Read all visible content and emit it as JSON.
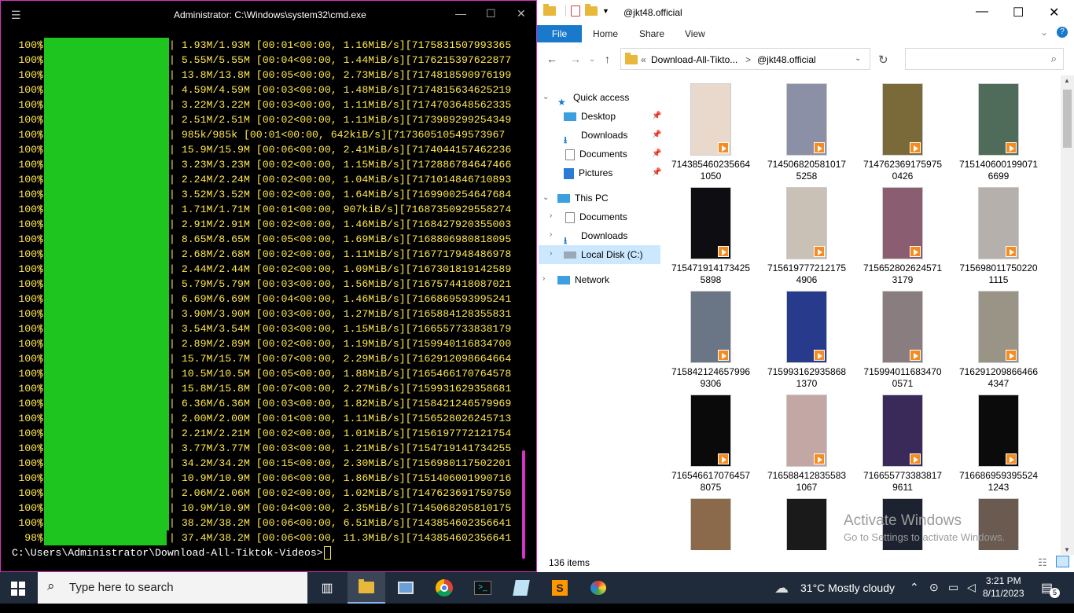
{
  "cmd": {
    "title": "Administrator: C:\\Windows\\system32\\cmd.exe",
    "rows": [
      {
        "pct": "100%",
        "rest": "| 1.93M/1.93M [00:01<00:00, 1.16MiB/s][7175831507993365"
      },
      {
        "pct": "100%",
        "rest": "| 5.55M/5.55M [00:04<00:00, 1.44MiB/s][7176215397622877"
      },
      {
        "pct": "100%",
        "rest": "| 13.8M/13.8M [00:05<00:00, 2.73MiB/s][7174818590976199"
      },
      {
        "pct": "100%",
        "rest": "| 4.59M/4.59M [00:03<00:00, 1.48MiB/s][7174815634625219"
      },
      {
        "pct": "100%",
        "rest": "| 3.22M/3.22M [00:03<00:00, 1.11MiB/s][7174703648562335"
      },
      {
        "pct": "100%",
        "rest": "| 2.51M/2.51M [00:02<00:00, 1.11MiB/s][7173989299254349"
      },
      {
        "pct": "100%",
        "rest": "| 985k/985k [00:01<00:00, 642kiB/s][717360510549573967"
      },
      {
        "pct": "100%",
        "rest": "| 15.9M/15.9M [00:06<00:00, 2.41MiB/s][7174044157462236"
      },
      {
        "pct": "100%",
        "rest": "| 3.23M/3.23M [00:02<00:00, 1.15MiB/s][7172886784647466"
      },
      {
        "pct": "100%",
        "rest": "| 2.24M/2.24M [00:02<00:00, 1.04MiB/s][7171014846710893"
      },
      {
        "pct": "100%",
        "rest": "| 3.52M/3.52M [00:02<00:00, 1.64MiB/s][7169900254647684"
      },
      {
        "pct": "100%",
        "rest": "| 1.71M/1.71M [00:01<00:00, 907kiB/s][71687350929558274"
      },
      {
        "pct": "100%",
        "rest": "| 2.91M/2.91M [00:02<00:00, 1.46MiB/s][7168427920355003"
      },
      {
        "pct": "100%",
        "rest": "| 8.65M/8.65M [00:05<00:00, 1.69MiB/s][7168806980818095"
      },
      {
        "pct": "100%",
        "rest": "| 2.68M/2.68M [00:02<00:00, 1.11MiB/s][7167717948486978"
      },
      {
        "pct": "100%",
        "rest": "| 2.44M/2.44M [00:02<00:00, 1.09MiB/s][7167301819142589"
      },
      {
        "pct": "100%",
        "rest": "| 5.79M/5.79M [00:03<00:00, 1.56MiB/s][7167574418087021"
      },
      {
        "pct": "100%",
        "rest": "| 6.69M/6.69M [00:04<00:00, 1.46MiB/s][7166869593995241"
      },
      {
        "pct": "100%",
        "rest": "| 3.90M/3.90M [00:03<00:00, 1.27MiB/s][7165884128355831"
      },
      {
        "pct": "100%",
        "rest": "| 3.54M/3.54M [00:03<00:00, 1.15MiB/s][7166557733838179"
      },
      {
        "pct": "100%",
        "rest": "| 2.89M/2.89M [00:02<00:00, 1.19MiB/s][7159940116834700"
      },
      {
        "pct": "100%",
        "rest": "| 15.7M/15.7M [00:07<00:00, 2.29MiB/s][7162912098664664"
      },
      {
        "pct": "100%",
        "rest": "| 10.5M/10.5M [00:05<00:00, 1.88MiB/s][7165466170764578"
      },
      {
        "pct": "100%",
        "rest": "| 15.8M/15.8M [00:07<00:00, 2.27MiB/s][7159931629358681"
      },
      {
        "pct": "100%",
        "rest": "| 6.36M/6.36M [00:03<00:00, 1.82MiB/s][7158421246579969"
      },
      {
        "pct": "100%",
        "rest": "| 2.00M/2.00M [00:01<00:00, 1.11MiB/s][7156528026245713"
      },
      {
        "pct": "100%",
        "rest": "| 2.21M/2.21M [00:02<00:00, 1.01MiB/s][7156197772121754"
      },
      {
        "pct": "100%",
        "rest": "| 3.77M/3.77M [00:03<00:00, 1.21MiB/s][7154719141734255"
      },
      {
        "pct": "100%",
        "rest": "| 34.2M/34.2M [00:15<00:00, 2.30MiB/s][7156980117502201"
      },
      {
        "pct": "100%",
        "rest": "| 10.9M/10.9M [00:06<00:00, 1.86MiB/s][7151406001990716"
      },
      {
        "pct": "100%",
        "rest": "| 2.06M/2.06M [00:02<00:00, 1.02MiB/s][7147623691759750"
      },
      {
        "pct": "100%",
        "rest": "| 10.9M/10.9M [00:04<00:00, 2.35MiB/s][7145068205810175"
      },
      {
        "pct": "100%",
        "rest": "| 38.2M/38.2M [00:06<00:00, 6.51MiB/s][7143854602356641"
      },
      {
        "pct": "98%",
        "rest": "| 37.4M/38.2M [00:06<00:00, 11.3MiB/s][7143854602356641"
      }
    ],
    "last_progress": 0.98,
    "prompt": "C:\\Users\\Administrator\\Download-All-Tiktok-Videos>"
  },
  "explorer": {
    "title": "@jkt48.official",
    "ribbon": {
      "file": "File",
      "home": "Home",
      "share": "Share",
      "view": "View",
      "help": "?"
    },
    "address": {
      "crumbs": [
        "«",
        "Download-All-Tikto...",
        ">",
        "@jkt48.official"
      ]
    },
    "search_placeholder": "",
    "tree": {
      "quick_access": "Quick access",
      "desktop": "Desktop",
      "downloads": "Downloads",
      "documents": "Documents",
      "pictures": "Pictures",
      "this_pc": "This PC",
      "pc_documents": "Documents",
      "pc_downloads": "Downloads",
      "local_disk": "Local Disk (C:)",
      "network": "Network"
    },
    "files": [
      {
        "l1": "714385460235664",
        "l2": "1050",
        "c": "#e9d9cc"
      },
      {
        "l1": "714506820581017",
        "l2": "5258",
        "c": "#8c90a6"
      },
      {
        "l1": "714762369175975",
        "l2": "0426",
        "c": "#7a6a3a"
      },
      {
        "l1": "715140600199071",
        "l2": "6699",
        "c": "#4f6b5a"
      },
      {
        "l1": "715471914173425",
        "l2": "5898",
        "c": "#0d0d12"
      },
      {
        "l1": "715619777212175",
        "l2": "4906",
        "c": "#c9c1b5"
      },
      {
        "l1": "715652802624571",
        "l2": "3179",
        "c": "#8a5e70"
      },
      {
        "l1": "715698011750220",
        "l2": "1115",
        "c": "#b5b0ac"
      },
      {
        "l1": "715842124657996",
        "l2": "9306",
        "c": "#6a7586"
      },
      {
        "l1": "715993162935868",
        "l2": "1370",
        "c": "#273a8c"
      },
      {
        "l1": "715994011683470",
        "l2": "0571",
        "c": "#8a7d80"
      },
      {
        "l1": "716291209866466",
        "l2": "4347",
        "c": "#9a9486"
      },
      {
        "l1": "716546617076457",
        "l2": "8075",
        "c": "#0a0a0a"
      },
      {
        "l1": "716588412835583",
        "l2": "1067",
        "c": "#c2a7a5"
      },
      {
        "l1": "716655773383817",
        "l2": "9611",
        "c": "#3a2a5a"
      },
      {
        "l1": "716686959395524",
        "l2": "1243",
        "c": "#0b0b0b"
      },
      {
        "l1": "",
        "l2": "",
        "c": "#8a6a4a"
      },
      {
        "l1": "",
        "l2": "",
        "c": "#1a1a1a"
      },
      {
        "l1": "",
        "l2": "",
        "c": "#1c2230"
      },
      {
        "l1": "",
        "l2": "",
        "c": "#6a5a50"
      }
    ],
    "status": "136 items",
    "activate_title": "Activate Windows",
    "activate_sub": "Go to Settings to activate Windows."
  },
  "taskbar": {
    "search_label": "Type here to search",
    "weather": "31°C  Mostly cloudy",
    "time": "3:21 PM",
    "date": "8/11/2023",
    "notifications": "5",
    "colors": {
      "bar": "#1f2a3a",
      "accent": "#1979ca",
      "green": "#1ec51e",
      "term_text": "#ffe94d"
    }
  }
}
